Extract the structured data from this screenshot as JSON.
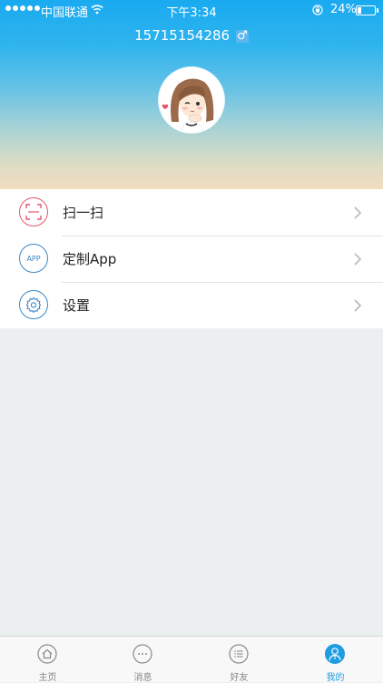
{
  "status_bar": {
    "carrier": "中国联通",
    "time": "下午3:34",
    "battery": "24%",
    "battery_level": 0.24
  },
  "profile": {
    "phone": "15715154286",
    "gender_symbol": "♂"
  },
  "menu": {
    "items": [
      {
        "label": "扫一扫",
        "icon": "scan-icon",
        "color": "#e2586a"
      },
      {
        "label": "定制App",
        "icon": "app-icon",
        "icon_text": "APP",
        "color": "#3b86c8"
      },
      {
        "label": "设置",
        "icon": "gear-icon",
        "color": "#3b86c8"
      }
    ]
  },
  "tabbar": {
    "items": [
      {
        "label": "主页",
        "icon": "home-icon"
      },
      {
        "label": "消息",
        "icon": "message-icon"
      },
      {
        "label": "好友",
        "icon": "friends-list-icon"
      },
      {
        "label": "我的",
        "icon": "profile-icon",
        "active": true
      }
    ]
  },
  "colors": {
    "accent": "#1f9de3",
    "header_top": "#19aaf0",
    "header_bottom": "#f1ddc0"
  }
}
